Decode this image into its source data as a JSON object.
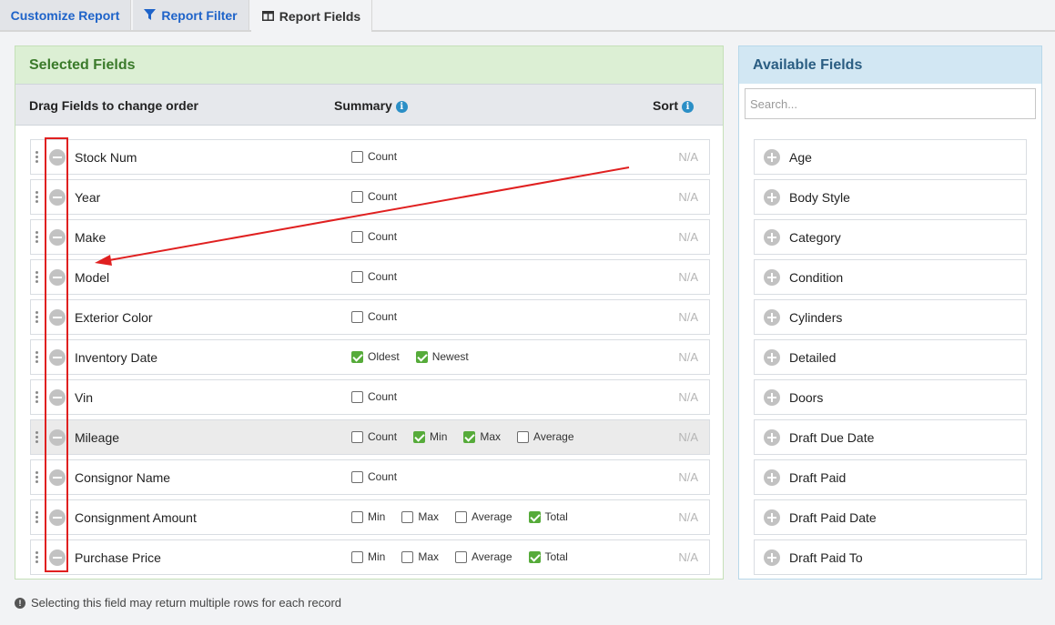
{
  "tabs": [
    {
      "label": "Customize Report",
      "icon": ""
    },
    {
      "label": "Report Filter",
      "icon": "filter-icon"
    },
    {
      "label": "Report Fields",
      "icon": "columns-icon"
    }
  ],
  "selected": {
    "title": "Selected Fields",
    "col_drag": "Drag Fields to change order",
    "col_summary": "Summary",
    "col_sort": "Sort",
    "info_glyph": "i",
    "rows": [
      {
        "name": "Stock Num",
        "options": [
          {
            "label": "Count",
            "checked": false
          }
        ],
        "sort": "N/A"
      },
      {
        "name": "Year",
        "options": [
          {
            "label": "Count",
            "checked": false
          }
        ],
        "sort": "N/A"
      },
      {
        "name": "Make",
        "options": [
          {
            "label": "Count",
            "checked": false
          }
        ],
        "sort": "N/A"
      },
      {
        "name": "Model",
        "options": [
          {
            "label": "Count",
            "checked": false
          }
        ],
        "sort": "N/A"
      },
      {
        "name": "Exterior Color",
        "options": [
          {
            "label": "Count",
            "checked": false
          }
        ],
        "sort": "N/A"
      },
      {
        "name": "Inventory Date",
        "options": [
          {
            "label": "Oldest",
            "checked": true
          },
          {
            "label": "Newest",
            "checked": true
          }
        ],
        "sort": "N/A"
      },
      {
        "name": "Vin",
        "options": [
          {
            "label": "Count",
            "checked": false
          }
        ],
        "sort": "N/A"
      },
      {
        "name": "Mileage",
        "options": [
          {
            "label": "Count",
            "checked": false
          },
          {
            "label": "Min",
            "checked": true
          },
          {
            "label": "Max",
            "checked": true
          },
          {
            "label": "Average",
            "checked": false
          }
        ],
        "sort": "N/A",
        "highlighted": true
      },
      {
        "name": "Consignor Name",
        "options": [
          {
            "label": "Count",
            "checked": false
          }
        ],
        "sort": "N/A"
      },
      {
        "name": "Consignment Amount",
        "options": [
          {
            "label": "Min",
            "checked": false
          },
          {
            "label": "Max",
            "checked": false
          },
          {
            "label": "Average",
            "checked": false
          },
          {
            "label": "Total",
            "checked": true
          }
        ],
        "sort": "N/A"
      },
      {
        "name": "Purchase Price",
        "options": [
          {
            "label": "Min",
            "checked": false
          },
          {
            "label": "Max",
            "checked": false
          },
          {
            "label": "Average",
            "checked": false
          },
          {
            "label": "Total",
            "checked": true
          }
        ],
        "sort": "N/A"
      }
    ]
  },
  "available": {
    "title": "Available Fields",
    "search_placeholder": "Search...",
    "items": [
      "Age",
      "Body Style",
      "Category",
      "Condition",
      "Cylinders",
      "Detailed",
      "Doors",
      "Draft Due Date",
      "Draft Paid",
      "Draft Paid Date",
      "Draft Paid To"
    ]
  },
  "footnote": {
    "glyph": "!",
    "text": "Selecting this field may return multiple rows for each record"
  },
  "colors": {
    "accent": "#1e63c9",
    "check": "#56ab3a",
    "annotation": "#e02020"
  }
}
